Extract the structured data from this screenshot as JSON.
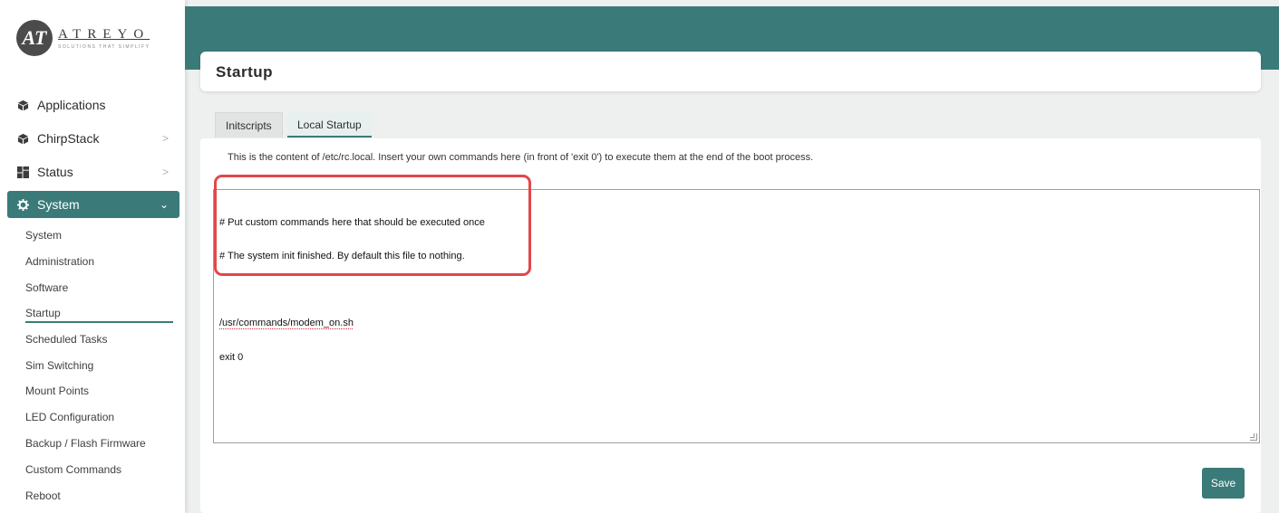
{
  "brand": {
    "name": "ATREYO",
    "tagline": "SOLUTIONS THAT SIMPLIFY",
    "mark": "AT"
  },
  "sidebar": {
    "items": [
      {
        "label": "Applications",
        "icon": "cube-icon"
      },
      {
        "label": "ChirpStack",
        "icon": "cube-icon",
        "chevron": ">"
      },
      {
        "label": "Status",
        "icon": "dashboard-icon",
        "chevron": ">"
      },
      {
        "label": "System",
        "icon": "gear-icon",
        "chevron": "⌄"
      }
    ],
    "system_subitems": [
      "System",
      "Administration",
      "Software",
      "Startup",
      "Scheduled Tasks",
      "Sim Switching",
      "Mount Points",
      "LED Configuration",
      "Backup / Flash Firmware",
      "Custom Commands",
      "Reboot"
    ],
    "current_subitem": "Startup"
  },
  "page": {
    "title": "Startup"
  },
  "tabs": [
    {
      "label": "Initscripts",
      "selected": false
    },
    {
      "label": "Local Startup",
      "selected": true
    }
  ],
  "local_startup": {
    "description": "This is the content of /etc/rc.local. Insert your own commands here (in front of 'exit 0') to execute them at the end of the boot process.",
    "editor_lines": [
      "# Put custom commands here that should be executed once",
      "# The system init finished. By default this file to nothing.",
      "",
      "/usr/commands/modem_on.sh",
      "exit 0"
    ],
    "save_label": "Save"
  },
  "colors": {
    "accent": "#3a7b79",
    "highlight_border": "#e2474a"
  }
}
